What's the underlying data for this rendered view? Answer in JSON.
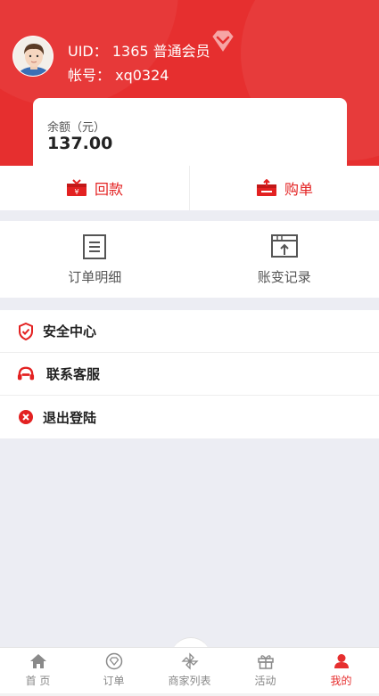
{
  "profile": {
    "uid_label": "UID：",
    "uid_value": "1365",
    "member_level": "普通会员",
    "account_label": "帐号：",
    "account_value": "xq0324"
  },
  "balance": {
    "label": "余额（元）",
    "amount": "137.00"
  },
  "actions": {
    "repay_label": "回款",
    "buy_label": "购单"
  },
  "features": {
    "order_detail_label": "订单明细",
    "account_change_label": "账变记录"
  },
  "menu": {
    "security_label": "安全中心",
    "support_label": "联系客服",
    "logout_label": "退出登陆"
  },
  "tabbar": {
    "home": "首 页",
    "orders": "订单",
    "merchants": "商家列表",
    "activity": "活动",
    "mine": "我的"
  },
  "colors": {
    "brand_red": "#e62f2f",
    "accent_red": "#e32121"
  }
}
